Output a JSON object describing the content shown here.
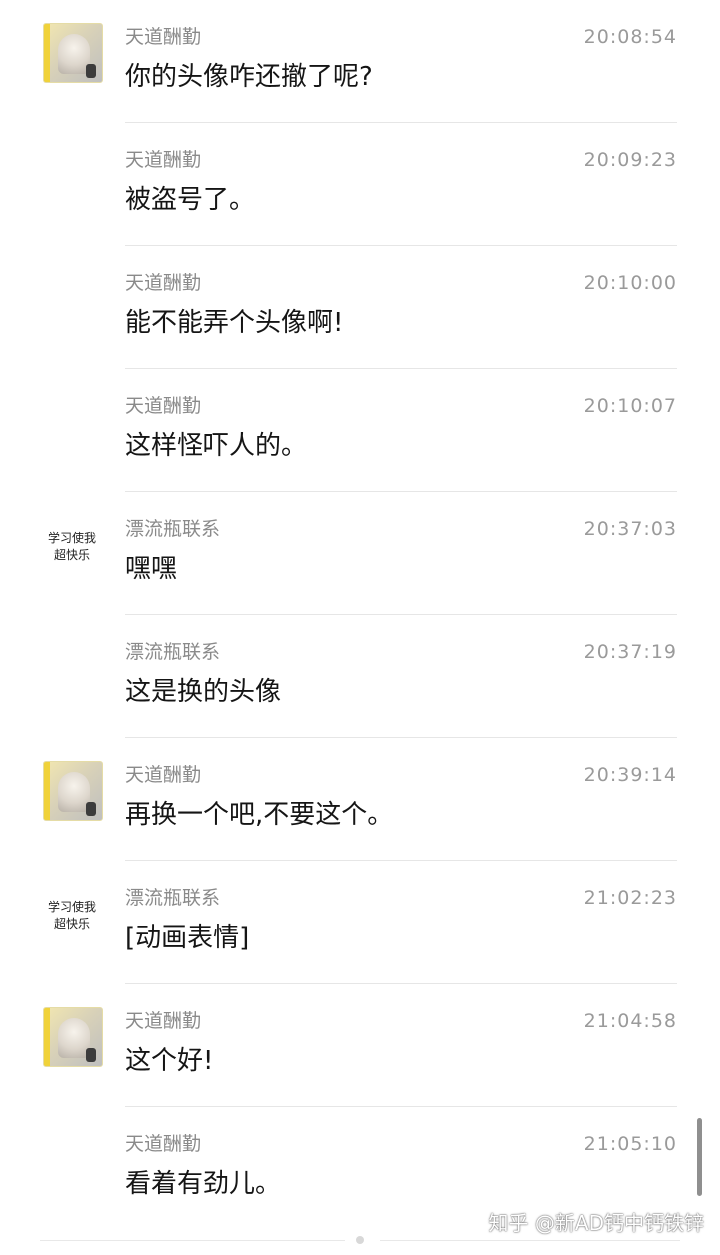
{
  "messages": [
    {
      "sender": "天道酬勤",
      "time": "20:08:54",
      "text": "你的头像咋还撤了呢?",
      "avatar": "photo"
    },
    {
      "sender": "天道酬勤",
      "time": "20:09:23",
      "text": "被盗号了。",
      "avatar": "none"
    },
    {
      "sender": "天道酬勤",
      "time": "20:10:00",
      "text": "能不能弄个头像啊!",
      "avatar": "none"
    },
    {
      "sender": "天道酬勤",
      "time": "20:10:07",
      "text": "这样怪吓人的。",
      "avatar": "none"
    },
    {
      "sender": "漂流瓶联系",
      "time": "20:37:03",
      "text": "嘿嘿",
      "avatar": "text",
      "avatar_text": "学习使我\n超快乐"
    },
    {
      "sender": "漂流瓶联系",
      "time": "20:37:19",
      "text": "这是换的头像",
      "avatar": "none"
    },
    {
      "sender": "天道酬勤",
      "time": "20:39:14",
      "text": "再换一个吧,不要这个。",
      "avatar": "photo"
    },
    {
      "sender": "漂流瓶联系",
      "time": "21:02:23",
      "text": "[动画表情]",
      "avatar": "text",
      "avatar_text": "学习使我\n超快乐"
    },
    {
      "sender": "天道酬勤",
      "time": "21:04:58",
      "text": "这个好!",
      "avatar": "photo"
    },
    {
      "sender": "天道酬勤",
      "time": "21:05:10",
      "text": "看着有劲儿。",
      "avatar": "none"
    }
  ],
  "watermark": "知乎 @新AD钙中钙铁锌",
  "colors": {
    "sender": "#8a8a8a",
    "time": "#9a9a9a",
    "message": "#151515",
    "divider": "#e6e6e6",
    "avatar_accent": "#f0d23a"
  }
}
